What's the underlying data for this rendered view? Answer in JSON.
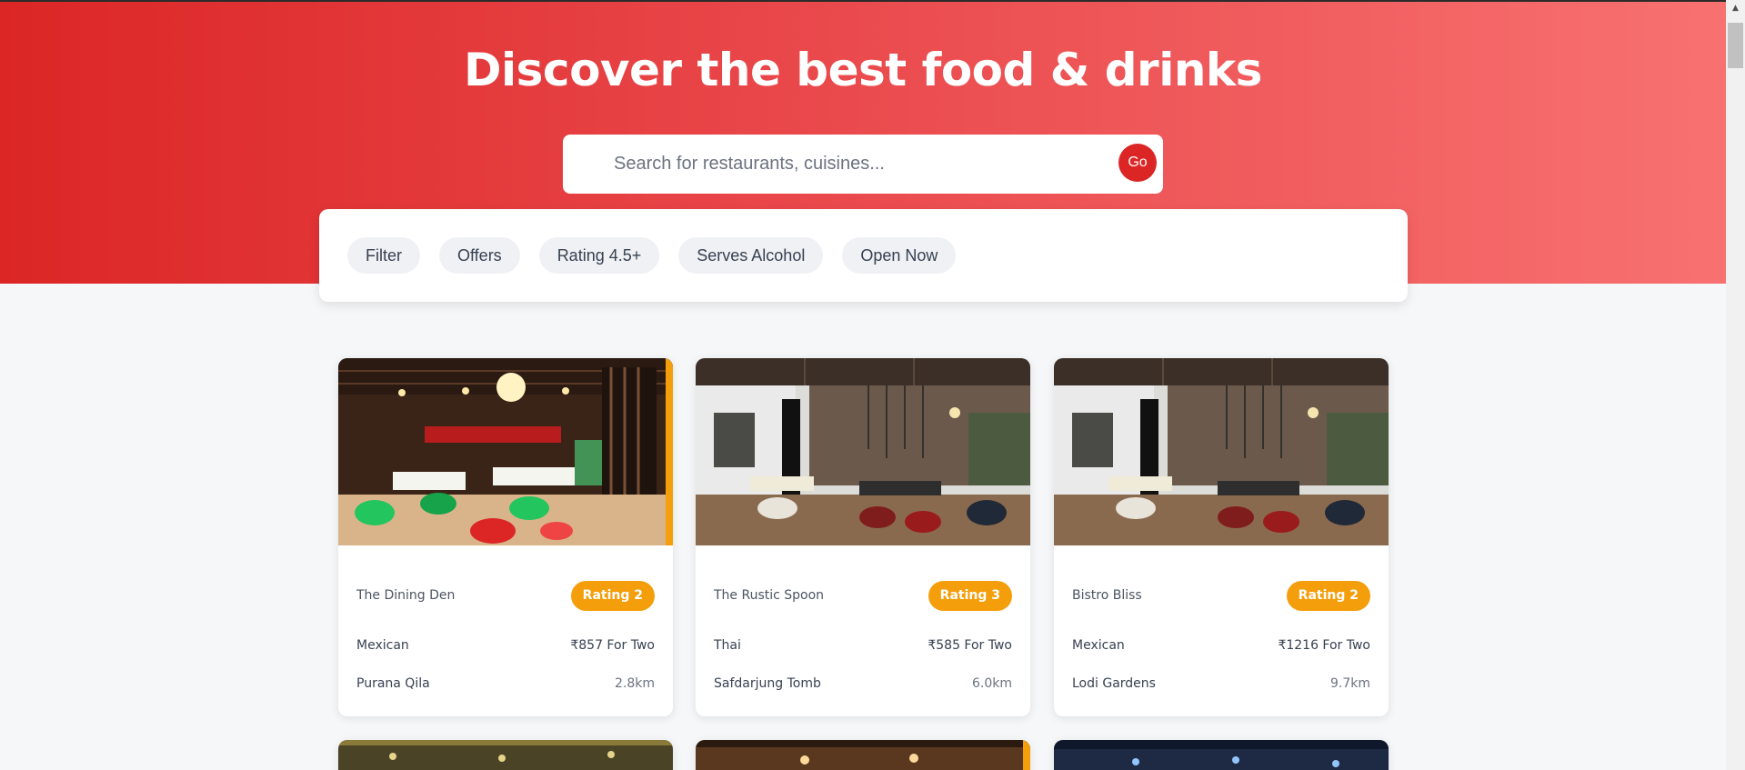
{
  "hero": {
    "title": "Discover the best food & drinks"
  },
  "search": {
    "placeholder": "Search for restaurants, cuisines...",
    "go_label": "Go"
  },
  "filters": [
    {
      "label": "Filter"
    },
    {
      "label": "Offers"
    },
    {
      "label": "Rating 4.5+"
    },
    {
      "label": "Serves Alcohol"
    },
    {
      "label": "Open Now"
    }
  ],
  "restaurants": [
    {
      "name": "The Dining Den",
      "rating": "Rating 2",
      "cuisine": "Mexican",
      "price": "₹857 For Two",
      "location": "Purana Qila",
      "distance": "2.8km",
      "image": "restaurant-photo-1"
    },
    {
      "name": "The Rustic Spoon",
      "rating": "Rating 3",
      "cuisine": "Thai",
      "price": "₹585 For Two",
      "location": "Safdarjung Tomb",
      "distance": "6.0km",
      "image": "restaurant-photo-2"
    },
    {
      "name": "Bistro Bliss",
      "rating": "Rating 2",
      "cuisine": "Mexican",
      "price": "₹1216 For Two",
      "location": "Lodi Gardens",
      "distance": "9.7km",
      "image": "restaurant-photo-3"
    }
  ],
  "colors": {
    "brand": "#dc2626",
    "rating_badge": "#f59e0b",
    "background": "#f6f7f9"
  }
}
